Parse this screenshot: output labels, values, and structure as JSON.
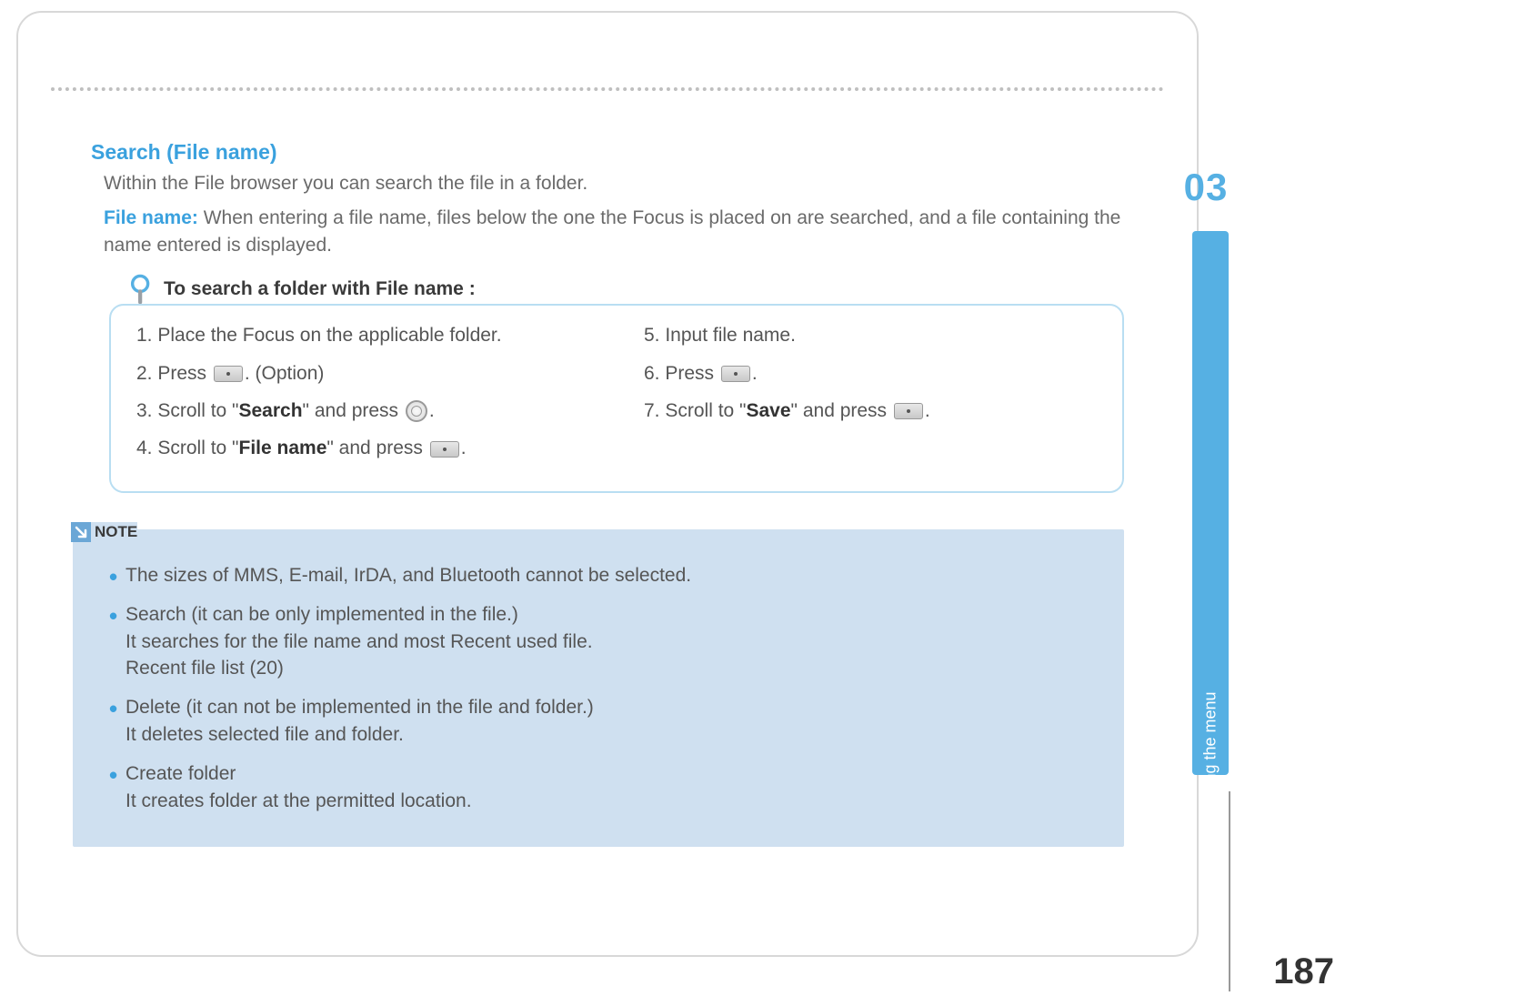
{
  "section": {
    "title": "Search (File name)",
    "intro": "Within the File browser you can search the file in a folder.",
    "file_name_label": "File name:",
    "file_name_text": " When entering a file name, files below the one the Focus is placed on are searched, and a file containing the name entered is displayed."
  },
  "steps": {
    "header": "To search a folder with File name :",
    "left": {
      "s1": "1.  Place the Focus on the applicable folder.",
      "s2a": "2.  Press ",
      "s2b": ".   (Option)",
      "s3a": "3.  Scroll to \"",
      "s3bold": "Search",
      "s3b": "\" and press ",
      "s3c": ".",
      "s4a": "4.  Scroll to \"",
      "s4bold": "File name",
      "s4b": "\" and press ",
      "s4c": "."
    },
    "right": {
      "s5": "5.  Input file name.",
      "s6a": "6.  Press ",
      "s6b": ".",
      "s7a": "7.  Scroll to \"",
      "s7bold": "Save",
      "s7b": "\" and press ",
      "s7c": "."
    }
  },
  "note": {
    "label": "NOTE",
    "items": {
      "n1": "The sizes of MMS, E-mail, IrDA, and Bluetooth cannot be selected.",
      "n2a": "Search (it can be only implemented in the file.)",
      "n2b": "It searches for the file name and most Recent used file.",
      "n2c": "Recent file list (20)",
      "n3a": "Delete (it can not be implemented in the file and folder.)",
      "n3b": "It deletes selected file and folder.",
      "n4a": "Create folder",
      "n4b": "It creates folder at the permitted location."
    }
  },
  "chapter": {
    "number": "03",
    "label": "Using the menu"
  },
  "page_number": "187"
}
